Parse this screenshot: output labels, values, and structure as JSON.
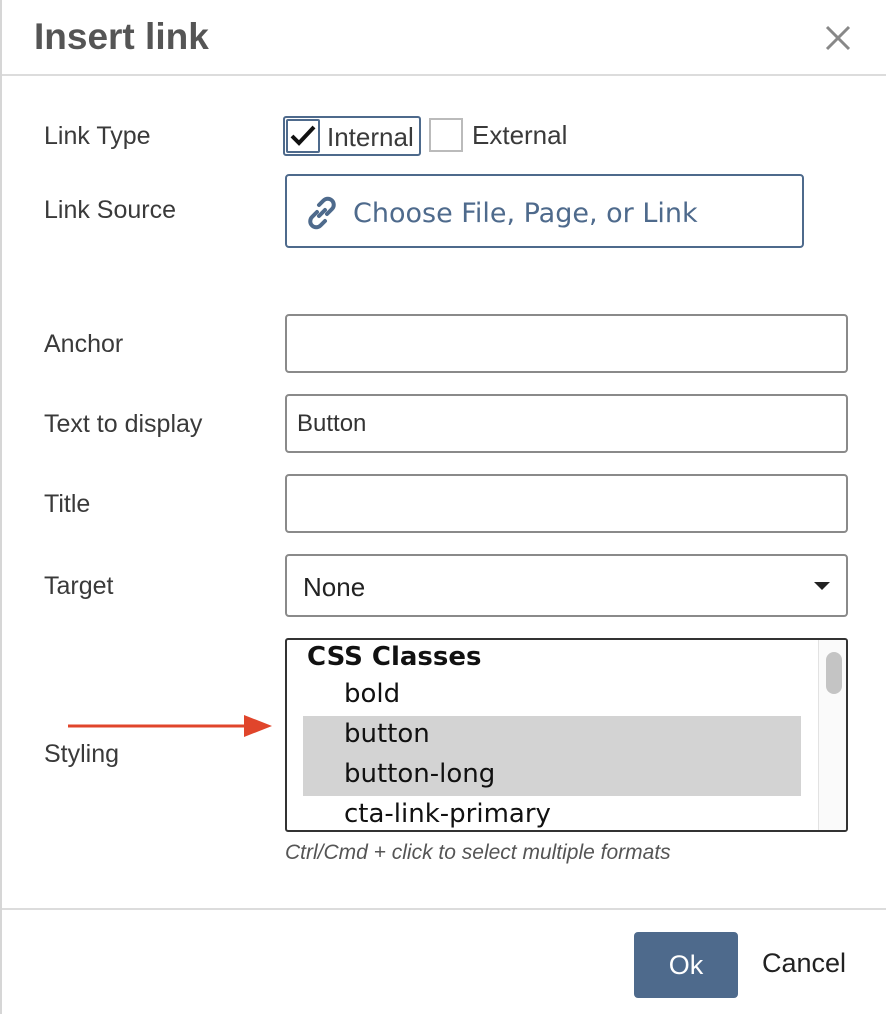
{
  "dialog": {
    "title": "Insert link",
    "close_icon": "close-icon"
  },
  "form": {
    "link_type": {
      "label": "Link Type",
      "options": [
        {
          "label": "Internal",
          "checked": true
        },
        {
          "label": "External",
          "checked": false
        }
      ]
    },
    "link_source": {
      "label": "Link Source",
      "button_label": "Choose File, Page, or Link",
      "icon": "link-icon"
    },
    "anchor": {
      "label": "Anchor",
      "value": ""
    },
    "text_to_display": {
      "label": "Text to display",
      "value": "Button"
    },
    "title": {
      "label": "Title",
      "value": ""
    },
    "target": {
      "label": "Target",
      "selected": "None"
    },
    "styling": {
      "label": "Styling",
      "group_label": "CSS Classes",
      "options": [
        {
          "label": "bold",
          "selected": false
        },
        {
          "label": "button",
          "selected": true
        },
        {
          "label": "button-long",
          "selected": true
        },
        {
          "label": "cta-link-primary",
          "selected": false
        }
      ],
      "hint": "Ctrl/Cmd + click to select multiple formats"
    }
  },
  "footer": {
    "ok_label": "Ok",
    "cancel_label": "Cancel"
  },
  "colors": {
    "accent": "#4e6a8c",
    "annotation_arrow": "#e0452b",
    "selected_option_bg": "#d3d3d3"
  }
}
